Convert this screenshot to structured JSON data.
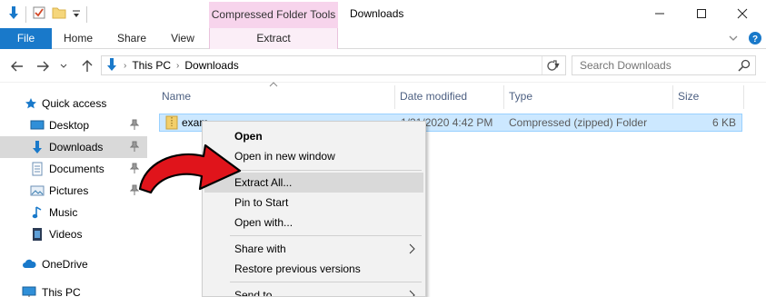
{
  "window": {
    "title": "Downloads",
    "contextual_group": "Compressed Folder Tools",
    "accent": "#1979ca",
    "contextual_color": "#f7d4ec"
  },
  "ribbon": {
    "tabs": [
      {
        "label": "File"
      },
      {
        "label": "Home"
      },
      {
        "label": "Share"
      },
      {
        "label": "View"
      },
      {
        "label": "Extract"
      }
    ]
  },
  "address": {
    "crumbs": [
      "This PC",
      "Downloads"
    ],
    "search_placeholder": "Search Downloads"
  },
  "nav": {
    "items": [
      {
        "label": "Quick access",
        "icon": "star-icon"
      },
      {
        "label": "Desktop",
        "icon": "desktop-icon",
        "pinned": true
      },
      {
        "label": "Downloads",
        "icon": "download-arrow-icon",
        "pinned": true,
        "selected": true
      },
      {
        "label": "Documents",
        "icon": "documents-icon",
        "pinned": true
      },
      {
        "label": "Pictures",
        "icon": "pictures-icon",
        "pinned": true
      },
      {
        "label": "Music",
        "icon": "music-note-icon"
      },
      {
        "label": "Videos",
        "icon": "videos-icon"
      },
      {
        "label": "OneDrive",
        "icon": "cloud-icon"
      },
      {
        "label": "This PC",
        "icon": "computer-icon"
      }
    ]
  },
  "columns": {
    "name": "Name",
    "date": "Date modified",
    "type": "Type",
    "size": "Size"
  },
  "file": {
    "name": "exam...",
    "date": "1/31/2020 4:42 PM",
    "type": "Compressed (zipped) Folder",
    "size": "6 KB"
  },
  "menu": {
    "items": [
      {
        "label": "Open",
        "bold": true
      },
      {
        "label": "Open in new window"
      },
      {
        "label": "Extract All...",
        "highlighted": true
      },
      {
        "label": "Pin to Start"
      },
      {
        "label": "Open with..."
      },
      {
        "label": "Share with",
        "submenu": true
      },
      {
        "label": "Restore previous versions"
      },
      {
        "label": "Send to",
        "submenu": true
      }
    ]
  },
  "annotation_color": "#e0141b"
}
